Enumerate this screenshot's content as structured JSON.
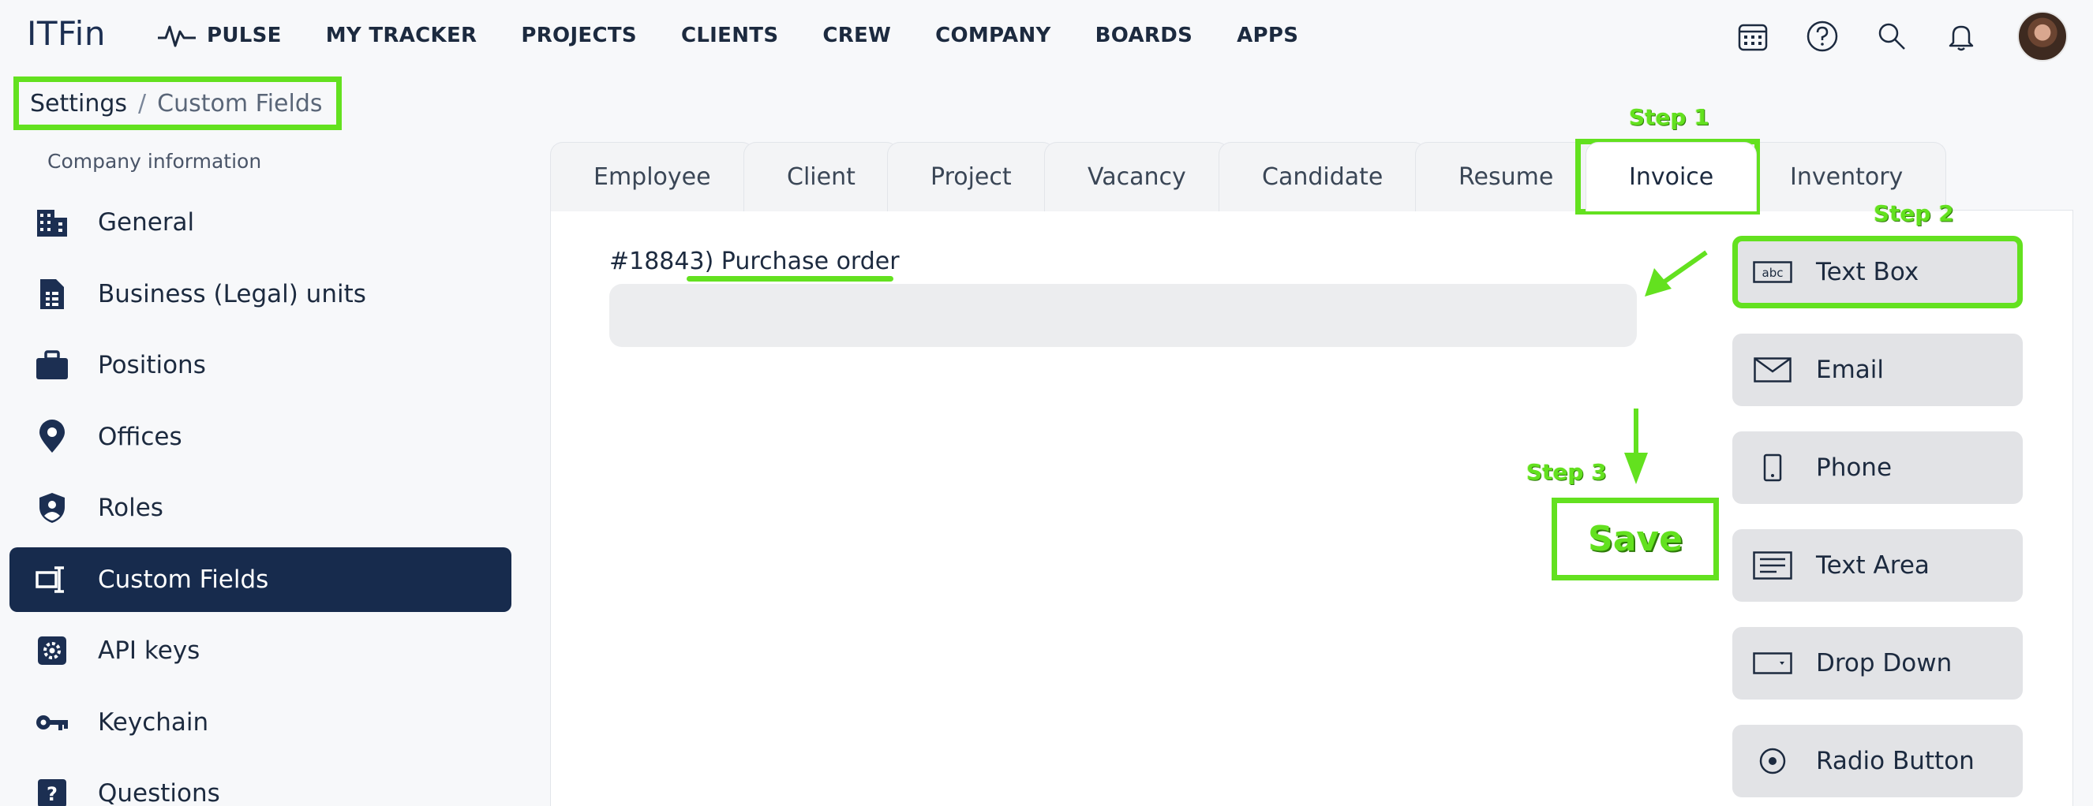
{
  "app": {
    "logo": "ITFin"
  },
  "nav": {
    "items": [
      "PULSE",
      "MY TRACKER",
      "PROJECTS",
      "CLIENTS",
      "CREW",
      "COMPANY",
      "BOARDS",
      "APPS"
    ]
  },
  "top_icons": [
    "calendar-icon",
    "help-icon",
    "search-icon",
    "bell-icon"
  ],
  "breadcrumb": {
    "parent": "Settings",
    "separator": "/",
    "current": "Custom Fields"
  },
  "sidebar": {
    "heading": "Company information",
    "items": [
      {
        "label": "General",
        "icon": "building-icon"
      },
      {
        "label": "Business (Legal) units",
        "icon": "document-icon"
      },
      {
        "label": "Positions",
        "icon": "briefcase-icon"
      },
      {
        "label": "Offices",
        "icon": "location-pin-icon"
      },
      {
        "label": "Roles",
        "icon": "shield-user-icon"
      },
      {
        "label": "Custom Fields",
        "icon": "custom-field-icon",
        "active": true
      },
      {
        "label": "API keys",
        "icon": "gear-box-icon"
      },
      {
        "label": "Keychain",
        "icon": "key-icon"
      },
      {
        "label": "Questions",
        "icon": "question-box-icon"
      }
    ]
  },
  "tabs": [
    {
      "label": "Employee"
    },
    {
      "label": "Client"
    },
    {
      "label": "Project"
    },
    {
      "label": "Vacancy"
    },
    {
      "label": "Candidate"
    },
    {
      "label": "Resume"
    },
    {
      "label": "Invoice",
      "selected": true
    },
    {
      "label": "Inventory"
    }
  ],
  "field": {
    "label": "#18843) Purchase order",
    "value": ""
  },
  "palette": [
    {
      "label": "Text Box",
      "icon": "textbox-icon"
    },
    {
      "label": "Email",
      "icon": "envelope-icon"
    },
    {
      "label": "Phone",
      "icon": "phone-icon"
    },
    {
      "label": "Text Area",
      "icon": "textarea-icon"
    },
    {
      "label": "Drop Down",
      "icon": "dropdown-icon"
    },
    {
      "label": "Radio Button",
      "icon": "radio-icon"
    }
  ],
  "annotations": {
    "step1": "Step 1",
    "step2": "Step 2",
    "step3": "Step 3",
    "save": "Save"
  },
  "colors": {
    "accent": "#63e11f",
    "sidebar_active": "#172b4d"
  }
}
